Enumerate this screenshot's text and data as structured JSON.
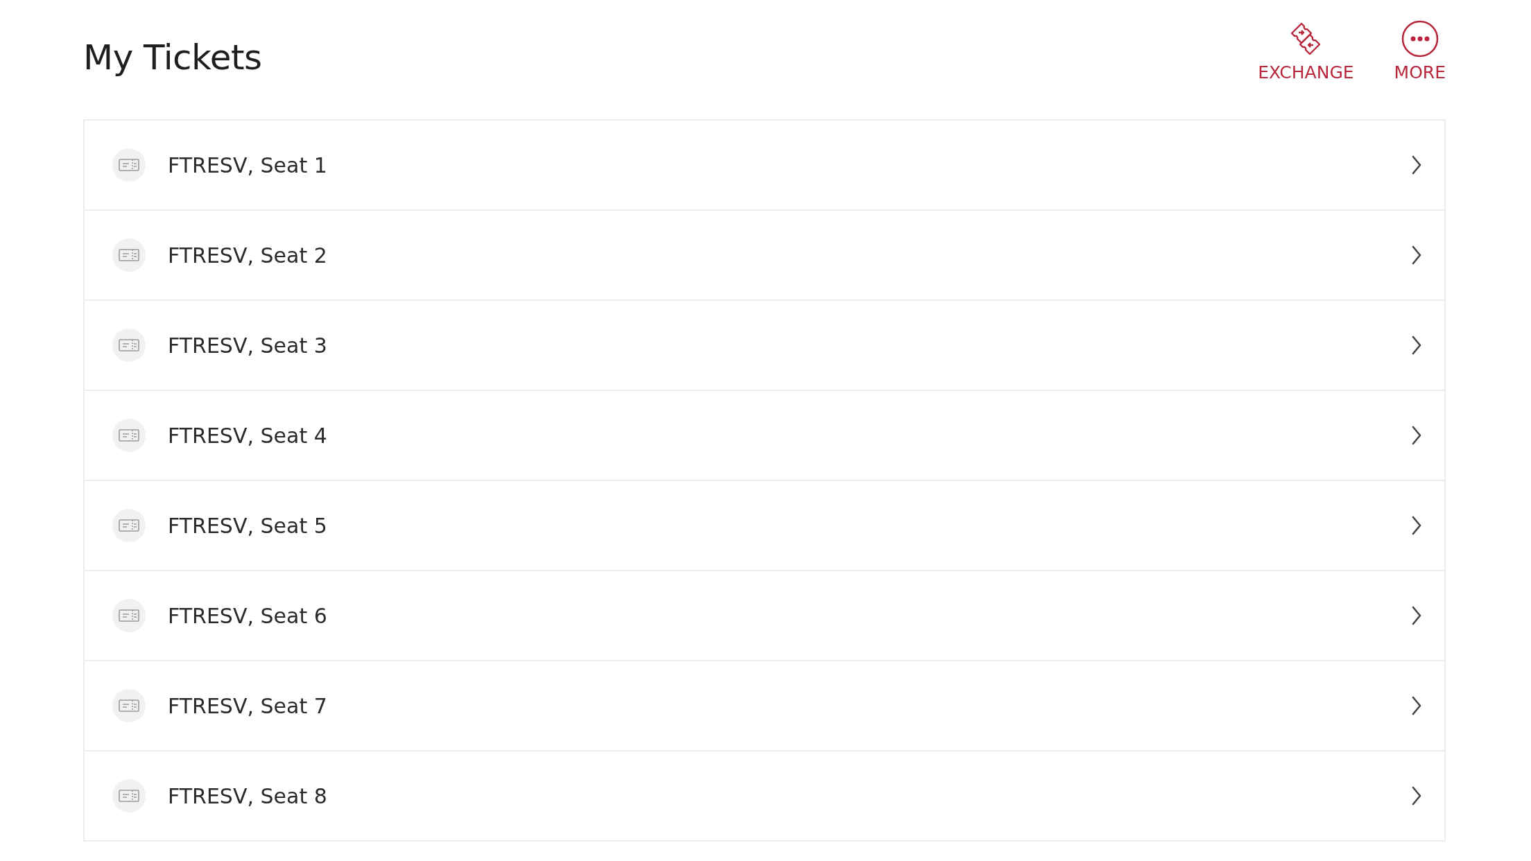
{
  "header": {
    "title": "My Tickets",
    "actions": [
      {
        "kind": "exchange",
        "label": "EXCHANGE"
      },
      {
        "kind": "more",
        "label": "MORE"
      }
    ]
  },
  "tickets": [
    {
      "label": "FTRESV, Seat 1"
    },
    {
      "label": "FTRESV, Seat 2"
    },
    {
      "label": "FTRESV, Seat 3"
    },
    {
      "label": "FTRESV, Seat 4"
    },
    {
      "label": "FTRESV, Seat 5"
    },
    {
      "label": "FTRESV, Seat 6"
    },
    {
      "label": "FTRESV, Seat 7"
    },
    {
      "label": "FTRESV, Seat 8"
    }
  ]
}
